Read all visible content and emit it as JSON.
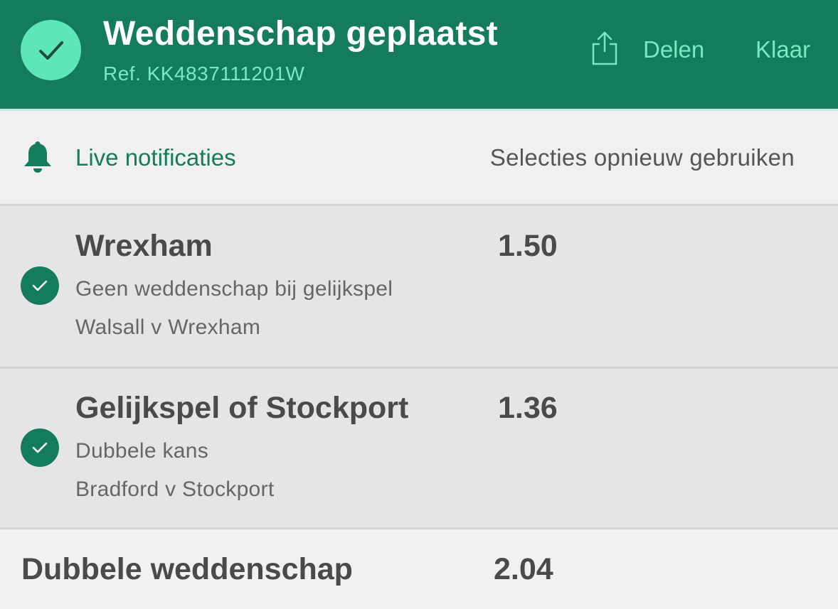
{
  "header": {
    "title": "Weddenschap geplaatst",
    "ref": "Ref. KK4837111201W",
    "share_label": "Delen",
    "done_label": "Klaar",
    "check_icon": "check-circle-icon",
    "share_icon": "share-icon"
  },
  "actions": {
    "live_label": "Live notificaties",
    "live_icon": "bell-icon",
    "reuse_label": "Selecties opnieuw gebruiken"
  },
  "selections": [
    {
      "name": "Wrexham",
      "odds": "1.50",
      "market": "Geen weddenschap bij gelijkspel",
      "event": "Walsall v Wrexham"
    },
    {
      "name": "Gelijkspel of Stockport",
      "odds": "1.36",
      "market": "Dubbele kans",
      "event": "Bradford v Stockport"
    }
  ],
  "total": {
    "label": "Dubbele weddenschap",
    "odds": "2.04"
  },
  "colors": {
    "brand_green": "#147b5c",
    "accent_mint": "#5de6b8",
    "light_mint_text": "#7fe6c3"
  }
}
